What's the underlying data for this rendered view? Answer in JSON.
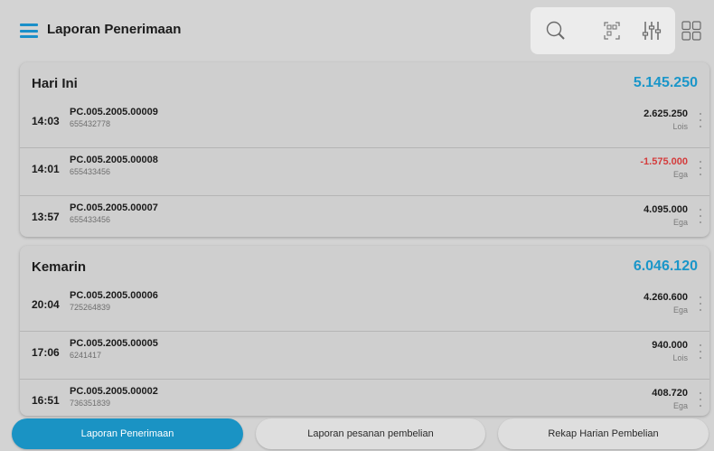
{
  "header": {
    "title": "Laporan Penerimaan",
    "icons": [
      "menu-icon",
      "search-icon",
      "scan-icon",
      "filter-icon",
      "grid-view-icon"
    ]
  },
  "colors": {
    "accent": "#1a93c4",
    "negative": "#d43c3c"
  },
  "sections": [
    {
      "title": "Hari Ini",
      "total": "5.145.250",
      "rows": [
        {
          "time": "14:03",
          "code": "PC.005.2005.00009",
          "sub": "655432778",
          "amount": "2.625.250",
          "person": "Lois",
          "negative": false
        },
        {
          "time": "14:01",
          "code": "PC.005.2005.00008",
          "sub": "655433456",
          "amount": "-1.575.000",
          "person": "Ega",
          "negative": true
        },
        {
          "time": "13:57",
          "code": "PC.005.2005.00007",
          "sub": "655433456",
          "amount": "4.095.000",
          "person": "Ega",
          "negative": false
        }
      ]
    },
    {
      "title": "Kemarin",
      "total": "6.046.120",
      "rows": [
        {
          "time": "20:04",
          "code": "PC.005.2005.00006",
          "sub": "725264839",
          "amount": "4.260.600",
          "person": "Ega",
          "negative": false
        },
        {
          "time": "17:06",
          "code": "PC.005.2005.00005",
          "sub": "6241417",
          "amount": "940.000",
          "person": "Lois",
          "negative": false
        },
        {
          "time": "16:51",
          "code": "PC.005.2005.00002",
          "sub": "736351839",
          "amount": "408.720",
          "person": "Ega",
          "negative": false
        }
      ]
    }
  ],
  "tabs": [
    {
      "label": "Laporan Penerimaan",
      "active": true
    },
    {
      "label": "Laporan pesanan pembelian",
      "active": false
    },
    {
      "label": "Rekap Harian Pembelian",
      "active": false
    }
  ]
}
